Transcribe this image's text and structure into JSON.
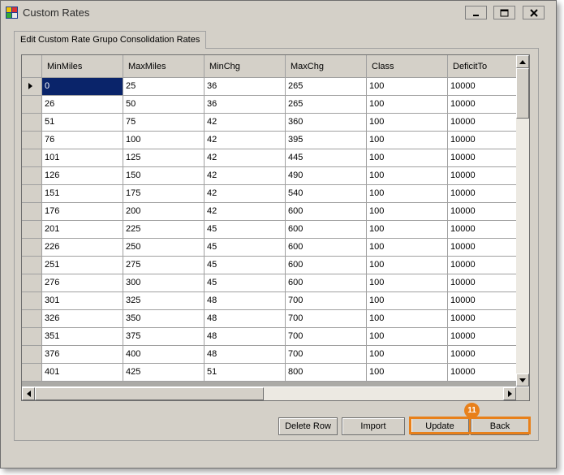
{
  "window": {
    "title": "Custom Rates"
  },
  "tab": {
    "label": "Edit Custom Rate Grupo Consolidation Rates"
  },
  "grid": {
    "columns": [
      "MinMiles",
      "MaxMiles",
      "MinChg",
      "MaxChg",
      "Class",
      "DeficitTo"
    ],
    "rows": [
      [
        "0",
        "25",
        "36",
        "265",
        "100",
        "10000"
      ],
      [
        "26",
        "50",
        "36",
        "265",
        "100",
        "10000"
      ],
      [
        "51",
        "75",
        "42",
        "360",
        "100",
        "10000"
      ],
      [
        "76",
        "100",
        "42",
        "395",
        "100",
        "10000"
      ],
      [
        "101",
        "125",
        "42",
        "445",
        "100",
        "10000"
      ],
      [
        "126",
        "150",
        "42",
        "490",
        "100",
        "10000"
      ],
      [
        "151",
        "175",
        "42",
        "540",
        "100",
        "10000"
      ],
      [
        "176",
        "200",
        "42",
        "600",
        "100",
        "10000"
      ],
      [
        "201",
        "225",
        "45",
        "600",
        "100",
        "10000"
      ],
      [
        "226",
        "250",
        "45",
        "600",
        "100",
        "10000"
      ],
      [
        "251",
        "275",
        "45",
        "600",
        "100",
        "10000"
      ],
      [
        "276",
        "300",
        "45",
        "600",
        "100",
        "10000"
      ],
      [
        "301",
        "325",
        "48",
        "700",
        "100",
        "10000"
      ],
      [
        "326",
        "350",
        "48",
        "700",
        "100",
        "10000"
      ],
      [
        "351",
        "375",
        "48",
        "700",
        "100",
        "10000"
      ],
      [
        "376",
        "400",
        "48",
        "700",
        "100",
        "10000"
      ],
      [
        "401",
        "425",
        "51",
        "800",
        "100",
        "10000"
      ]
    ]
  },
  "buttons": {
    "delete_row": "Delete Row",
    "import": "Import",
    "update": "Update",
    "back": "Back"
  },
  "callout": {
    "number": "11"
  },
  "colors": {
    "accent": "#e8801a",
    "selection": "#0a246a",
    "face": "#d4d0c8"
  }
}
